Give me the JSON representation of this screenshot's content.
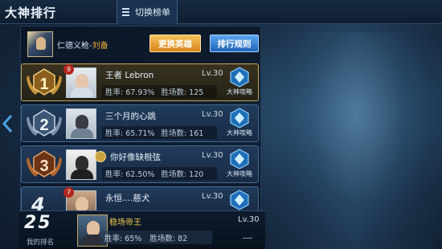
{
  "header": {
    "title": "大神排行",
    "switch_label": "切换榜单"
  },
  "user": {
    "name_prefix": "仁德义枪-",
    "hero": "刘备",
    "change_hero": "更换英雄",
    "rules": "排行规则"
  },
  "guide_label": "大神攻略",
  "ranks": [
    {
      "rank": "1",
      "name": "王者 Lebron",
      "level": "Lv.30",
      "winrate_label": "胜率: 67.93%",
      "games_label": "胜场数: 125",
      "tag": "9",
      "style": "gold"
    },
    {
      "rank": "2",
      "name": "三个月的心跳",
      "level": "Lv.30",
      "winrate_label": "胜率: 65.71%",
      "games_label": "胜场数: 161",
      "tag": "",
      "style": "silver"
    },
    {
      "rank": "3",
      "name": "你好像缺根弦",
      "level": "Lv.30",
      "winrate_label": "胜率: 62.50%",
      "games_label": "胜场数: 120",
      "tag": "",
      "style": "bronze"
    },
    {
      "rank": "4",
      "name": "永恒....慈犬",
      "level": "Lv.30",
      "winrate_label": "",
      "games_label": "",
      "tag": "7",
      "style": "plain"
    }
  ],
  "me": {
    "rank": "25",
    "rank_label": "我的排名",
    "name": "稳场帝王",
    "level": "Lv.30",
    "winrate_label": "胜率: 65%",
    "games_label": "胜场数: 82"
  },
  "colors": {
    "gold": "#f2b73c",
    "accent_blue": "#2f7ad1",
    "panel": "#172b44"
  }
}
